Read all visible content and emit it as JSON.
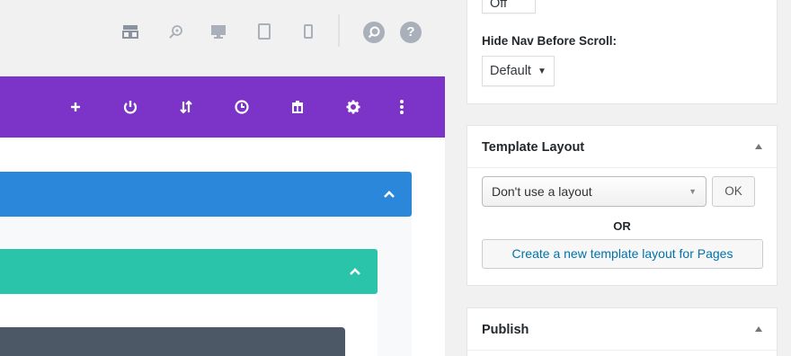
{
  "toolbar": {
    "icons": [
      "layout-icon",
      "zoom-icon",
      "desktop-icon",
      "tablet-icon",
      "phone-icon"
    ],
    "search_label": "⌕",
    "help_label": "?"
  },
  "section_bar": {
    "color": "#7b34c7",
    "icons": [
      "add-icon",
      "power-icon",
      "sort-icon",
      "history-icon",
      "trash-icon",
      "settings-icon",
      "more-icon"
    ]
  },
  "rows": {
    "row_color": "#2b87da",
    "module_color": "#29c4a9",
    "dark_module_color": "#4c5866"
  },
  "sidebar": {
    "top_panel": {
      "prev_select_value": "Off",
      "hide_nav_label": "Hide Nav Before Scroll:",
      "hide_nav_value": "Default"
    },
    "template_layout": {
      "title": "Template Layout",
      "dropdown_value": "Don't use a layout",
      "ok_label": "OK",
      "or_label": "OR",
      "create_label": "Create a new template layout for Pages"
    },
    "publish": {
      "title": "Publish"
    }
  }
}
